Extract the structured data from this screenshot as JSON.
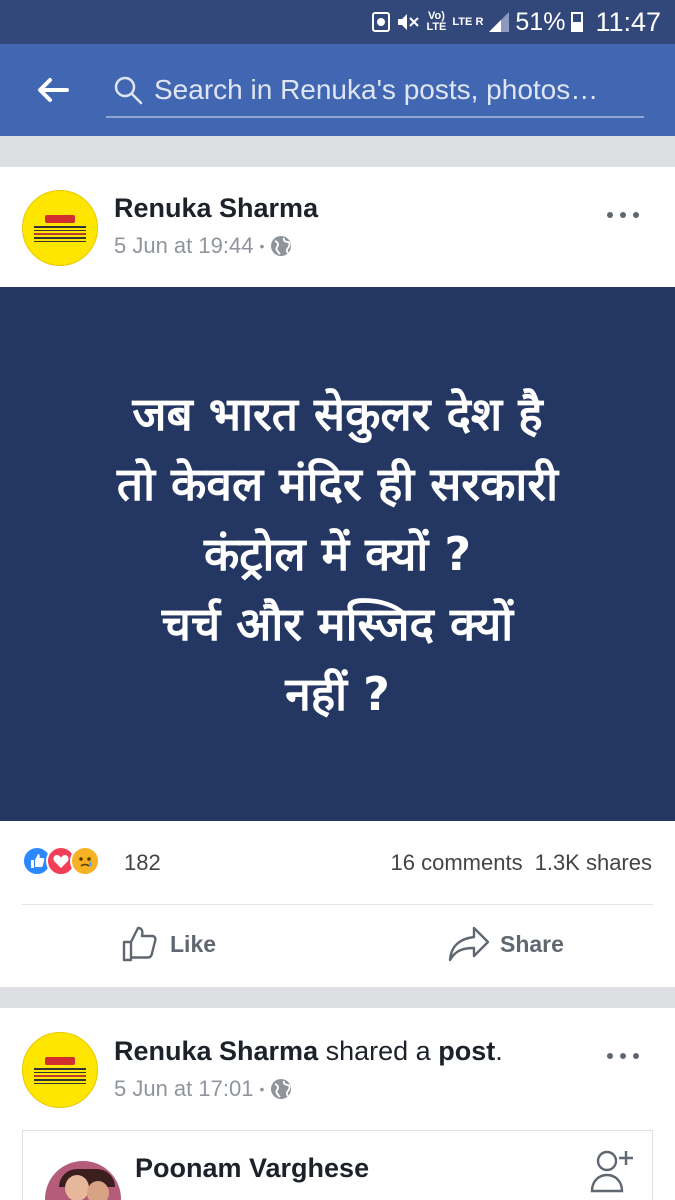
{
  "status_bar": {
    "volte": "Vo)",
    "volte_sub": "LTE",
    "lte": "LTE",
    "roaming": "R",
    "battery": "51%",
    "time": "11:47"
  },
  "search": {
    "placeholder": "Search in Renuka's posts, photos…"
  },
  "post1": {
    "author": "Renuka Sharma",
    "timestamp": "5 Jun at 19:44",
    "separator": "•",
    "image_text": "जब भारत सेकुलर देश है\nतो केवल मंदिर ही सरकारी\nकंट्रोल में क्यों ?\nचर्च और मस्जिद क्यों\nनहीं ?",
    "reactions_count": "182",
    "comments": "16 comments",
    "shares": "1.3K shares",
    "like_label": "Like",
    "share_label": "Share"
  },
  "post2": {
    "author": "Renuka Sharma",
    "shared_text": "shared a",
    "post_word": "post",
    "period": ".",
    "timestamp": "5 Jun at 17:01",
    "separator": "•",
    "shared_author": "Poonam Varghese"
  },
  "colors": {
    "header": "#4267b2",
    "status_bar": "#33487a",
    "post_bg": "#243763",
    "like_blue": "#2d88ff",
    "love_red": "#f33e58",
    "sad_yellow": "#f7b125"
  },
  "icons": [
    "back-arrow-icon",
    "search-icon",
    "globe-icon",
    "more-icon",
    "like-icon",
    "share-icon",
    "add-friend-icon"
  ]
}
